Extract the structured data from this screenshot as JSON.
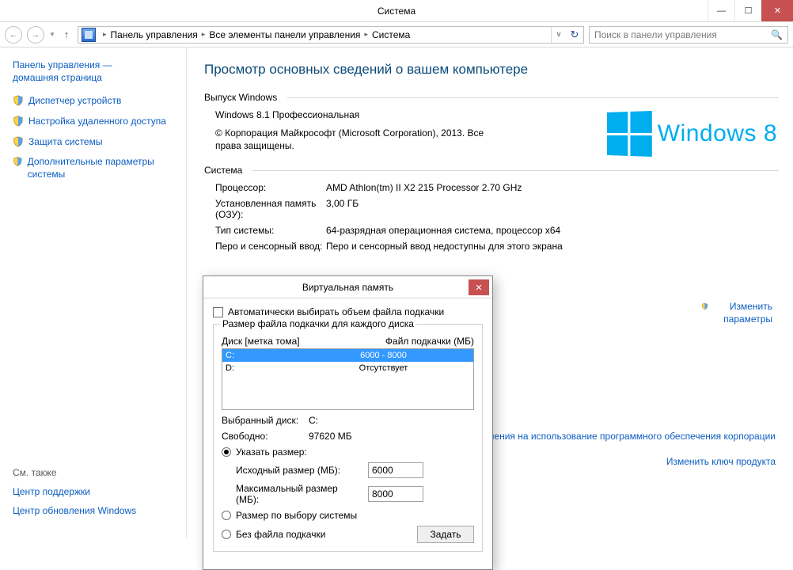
{
  "window": {
    "title": "Система",
    "minimize": "—",
    "maximize": "☐",
    "close": "✕"
  },
  "toolbar": {
    "back": "←",
    "forward": "→",
    "up": "↑",
    "breadcrumb": {
      "a": "Панель управления",
      "b": "Все элементы панели управления",
      "c": "Система"
    },
    "dropdown": "v",
    "refresh": "↻",
    "search_placeholder": "Поиск в панели управления",
    "search_icon": "🔍"
  },
  "sidebar": {
    "home1": "Панель управления —",
    "home2": "домашняя страница",
    "items": [
      "Диспетчер устройств",
      "Настройка удаленного доступа",
      "Защита системы",
      "Дополнительные параметры системы"
    ],
    "seealso": {
      "hdr": "См. также",
      "a": "Центр поддержки",
      "b": "Центр обновления Windows"
    }
  },
  "main": {
    "h1": "Просмотр основных сведений о вашем компьютере",
    "edition_group": "Выпуск Windows",
    "edition": "Windows 8.1 Профессиональная",
    "copyright": "© Корпорация Майкрософт (Microsoft Corporation), 2013. Все права защищены.",
    "winlogo_text": "Windows 8",
    "system_group": "Система",
    "proc_k": "Процессор:",
    "proc_v": "AMD Athlon(tm) II X2 215 Processor   2.70 GHz",
    "ram_k": "Установленная память (ОЗУ):",
    "ram_v": "3,00 ГБ",
    "type_k": "Тип системы:",
    "type_v": "64-разрядная операционная система, процессор x64",
    "pen_k": "Перо и сенсорный ввод:",
    "pen_v": "Перо и сенсорный ввод недоступны для этого экрана",
    "change_settings": "Изменить параметры",
    "license_tail": "соглашения на использование программного обеспечения корпорации",
    "product_key": "Изменить ключ продукта"
  },
  "dialog": {
    "title": "Виртуальная память",
    "close": "✕",
    "auto_chk": "Автоматически выбирать объем файла подкачки",
    "group_title": "Размер файла подкачки для каждого диска",
    "hdr_disk": "Диск [метка тома]",
    "hdr_pf": "Файл подкачки (МБ)",
    "disks": [
      {
        "d": "C:",
        "v": "6000 - 8000",
        "sel": true
      },
      {
        "d": "D:",
        "v": "Отсутствует",
        "sel": false
      }
    ],
    "sel_disk_k": "Выбранный диск:",
    "sel_disk_v": "C:",
    "free_k": "Свободно:",
    "free_v": "97620 МБ",
    "opt_custom": "Указать размер:",
    "init_k": "Исходный размер (МБ):",
    "init_v": "6000",
    "max_k": "Максимальный размер (МБ):",
    "max_v": "8000",
    "opt_sys": "Размер по выбору системы",
    "opt_none": "Без файла подкачки",
    "set_btn": "Задать"
  }
}
